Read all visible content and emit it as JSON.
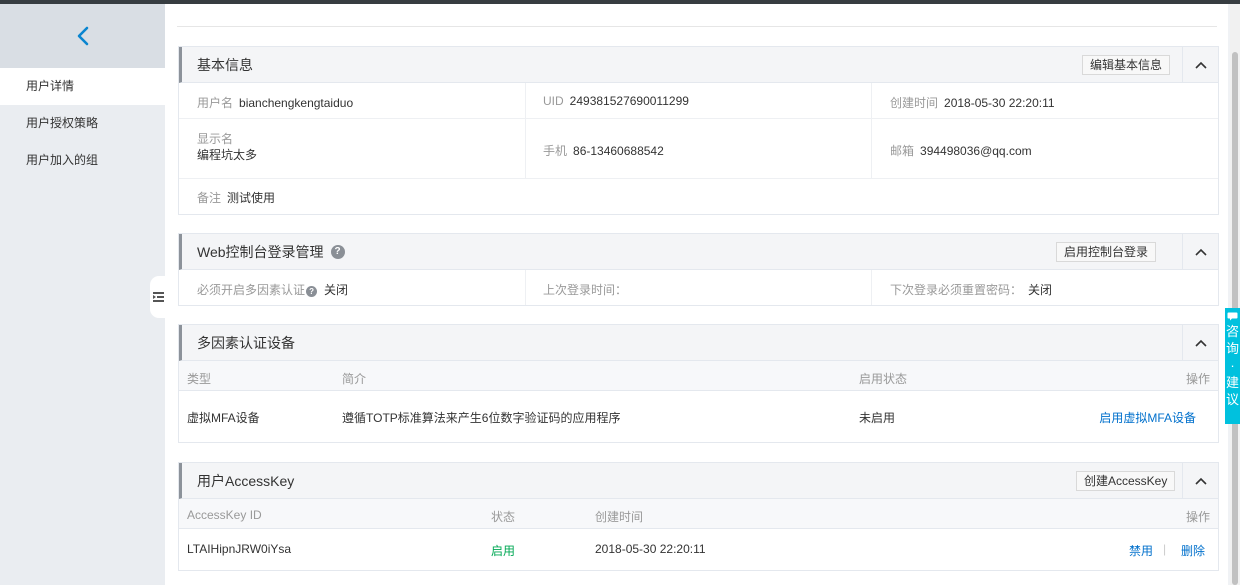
{
  "sidebar": {
    "items": [
      {
        "label": "用户详情"
      },
      {
        "label": "用户授权策略"
      },
      {
        "label": "用户加入的组"
      }
    ]
  },
  "basic_info": {
    "title": "基本信息",
    "edit_button": "编辑基本信息",
    "username_label": "用户名",
    "username": "bianchengkengtaiduo",
    "uid_label": "UID",
    "uid": "249381527690011299",
    "created_label": "创建时间",
    "created": "2018-05-30 22:20:11",
    "display_name_label": "显示名",
    "display_name": "编程坑太多",
    "phone_label": "手机",
    "phone": "86-13460688542",
    "email_label": "邮箱",
    "email": "394498036@qq.com",
    "note_label": "备注",
    "note": "测试使用"
  },
  "web_console": {
    "title": "Web控制台登录管理",
    "enable_button": "启用控制台登录",
    "mfa_required_label": "必须开启多因素认证",
    "mfa_required_value": "关闭",
    "last_login_label": "上次登录时间：",
    "last_login_value": "",
    "reset_pw_label": "下次登录必须重置密码：",
    "reset_pw_value": "关闭"
  },
  "mfa": {
    "title": "多因素认证设备",
    "columns": {
      "type": "类型",
      "desc": "简介",
      "status": "启用状态",
      "action": "操作"
    },
    "rows": [
      {
        "type": "虚拟MFA设备",
        "desc": "遵循TOTP标准算法来产生6位数字验证码的应用程序",
        "status": "未启用",
        "action": "启用虚拟MFA设备"
      }
    ]
  },
  "accesskey": {
    "title": "用户AccessKey",
    "create_button": "创建AccessKey",
    "columns": {
      "id": "AccessKey ID",
      "status": "状态",
      "created": "创建时间",
      "action": "操作"
    },
    "rows": [
      {
        "id": "LTAIHipnJRW0iYsa",
        "status": "启用",
        "created": "2018-05-30 22:20:11",
        "disable": "禁用",
        "sep": "|",
        "delete": "删除"
      }
    ]
  },
  "float_tab": {
    "label": "咨询·建议"
  },
  "colors": {
    "accent": "#0070cc",
    "enabled_green": "#00a854",
    "float_tab": "#00c1de",
    "back_arrow": "#0a85d0"
  }
}
